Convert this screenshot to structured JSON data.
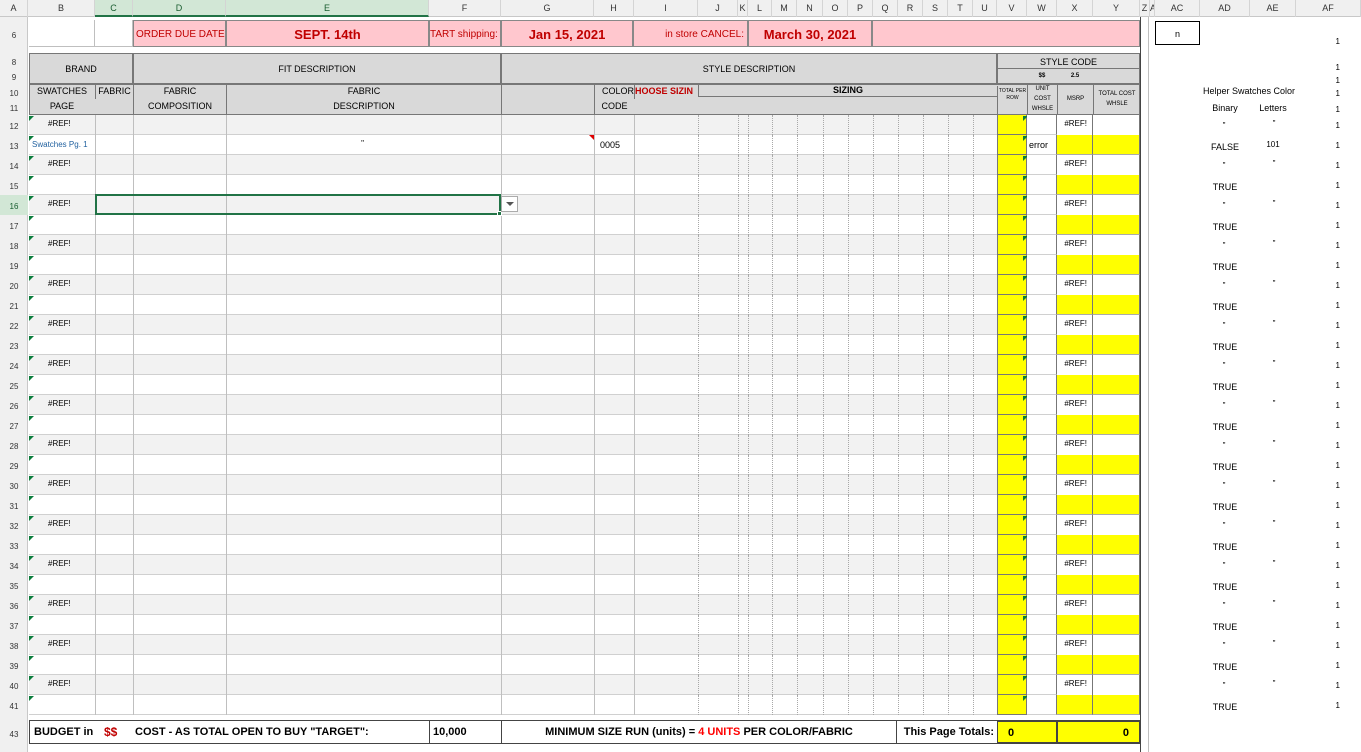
{
  "columns": [
    "A",
    "B",
    "C",
    "D",
    "E",
    "F",
    "G",
    "H",
    "I",
    "J",
    "K",
    "L",
    "M",
    "N",
    "O",
    "P",
    "Q",
    "R",
    "S",
    "T",
    "U",
    "V",
    "W",
    "X",
    "Y",
    "Z",
    "AA",
    "AC",
    "AD",
    "AE",
    "AF"
  ],
  "header": {
    "order_due_label": "ORDER DUE DATE:",
    "order_due_value": "SEPT. 14th",
    "start_shipping_label": "TART shipping:",
    "start_shipping_value": "Jan 15, 2021",
    "cancel_label": "in store CANCEL:",
    "cancel_value": "March 30, 2021",
    "ac6_value": "n",
    "brand": "BRAND",
    "fit_description": "FIT DESCRIPTION",
    "style_description": "STYLE DESCRIPTION",
    "style_code": "STYLE CODE",
    "dollar": "$$",
    "multiplier": "2.5",
    "swatches": "SWATCHES",
    "page": "PAGE",
    "fabric": "FABRIC",
    "fabric_comp_1": "FABRIC",
    "fabric_comp_2": "COMPOSITION",
    "fabric_desc_1": "FABRIC",
    "fabric_desc_2": "DESCRIPTION",
    "color": "COLOR",
    "code": "CODE",
    "choose_sizing": "HOOSE SIZIN",
    "sizing": "SIZING",
    "total_per_row": "TOTAL PER ROW",
    "unit_cost_whsle": "UNIT COST WHSLE",
    "msrp": "MSRP",
    "total_cost_whsle": "TOTAL COST WHSLE"
  },
  "helper": {
    "title": "Helper Swatches Color",
    "binary": "Binary",
    "letters": "Letters"
  },
  "row13": {
    "swatches": "Swatches Pg. 1",
    "fabric_desc": "\"",
    "color_code": "0005",
    "unit_cost": "error",
    "binary": "FALSE",
    "letters": "101"
  },
  "ref_error": "#REF!",
  "helper_true": "TRUE",
  "helper_blank_mark": "\"",
  "af_value": "1",
  "footer": {
    "budget_label": "BUDGET in",
    "currency": "$$",
    "cost_label": "COST - AS TOTAL OPEN TO BUY \"TARGET\":",
    "budget_value": "10,000",
    "min_run_prefix": "MINIMUM SIZE RUN (units) = ",
    "min_run_units": "4 UNITS",
    "min_run_suffix": " PER COLOR/FABRIC",
    "page_totals_label": "This Page Totals:",
    "total_units": "0",
    "total_cost": "0"
  },
  "colors": {
    "pink": "#ffc7ce",
    "header_gray": "#d9d9d9",
    "yellow": "#ffff00",
    "error_red": "#c00000",
    "excel_green": "#217346"
  }
}
